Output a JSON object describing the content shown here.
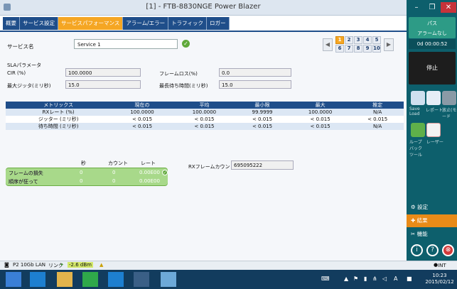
{
  "window": {
    "title": "[1] - FTB-8830NGE Power Blazer"
  },
  "tabs": [
    {
      "label": "概要"
    },
    {
      "label": "サービス設定"
    },
    {
      "label": "サービスパフォーマンス"
    },
    {
      "label": "アラーム/エラー"
    },
    {
      "label": "トラフィック"
    },
    {
      "label": "ロガー"
    }
  ],
  "service": {
    "label": "サービス名",
    "value": "Service 1"
  },
  "pager": {
    "pages": [
      "1",
      "2",
      "3",
      "4",
      "5",
      "6",
      "7",
      "8",
      "9",
      "10"
    ],
    "selected": "1"
  },
  "sla": {
    "title": "SLAパラメータ",
    "cir_label": "CIR (%)",
    "cir_value": "100.0000",
    "jitter_label": "最大ジッタ(ミリ秒)",
    "jitter_value": "15.0",
    "frameloss_label": "フレームロス(%)",
    "frameloss_value": "0.0",
    "latency_label": "最長待ち時間(ミリ秒)",
    "latency_value": "15.0"
  },
  "metrics": {
    "headers": [
      "メトリックス",
      "現在の",
      "平均",
      "最小限",
      "最大",
      "推定"
    ],
    "rows": [
      [
        "RXレート (%)",
        "100.0000",
        "100.0000",
        "99.9999",
        "100.0000",
        "N/A"
      ],
      [
        "ジッター (ミリ秒)",
        "< 0.015",
        "< 0.015",
        "< 0.015",
        "< 0.015",
        "< 0.015"
      ],
      [
        "待ち時間 (ミリ秒)",
        "< 0.015",
        "< 0.015",
        "< 0.015",
        "< 0.015",
        "N/A"
      ]
    ]
  },
  "frameloss": {
    "headers": [
      "秒",
      "カウント",
      "レート"
    ],
    "rows": [
      [
        "フレームの損失",
        "0",
        "0",
        "0.00E00"
      ],
      [
        "順序が狂って",
        "0",
        "0",
        "0.00E00"
      ]
    ]
  },
  "rx_frame": {
    "label": "RXフレームカウント",
    "value": "695095222"
  },
  "right_panel": {
    "status_title": "パス",
    "status_sub": "アラームなし",
    "timer": "0d 00:00:52",
    "stop": "停止",
    "save_load": "Save Load",
    "report": "レポート",
    "zero": "放止(モード",
    "loopback": "ループバック ツール",
    "laser": "レーザー",
    "menu": [
      "設定",
      "結果",
      "機能"
    ]
  },
  "statusbar": {
    "port": "P2 10Gb LAN",
    "link": "リンク",
    "power": "-2.6 dBm",
    "int": "INT"
  },
  "clock": {
    "time": "10:23",
    "date": "2015/02/12"
  }
}
